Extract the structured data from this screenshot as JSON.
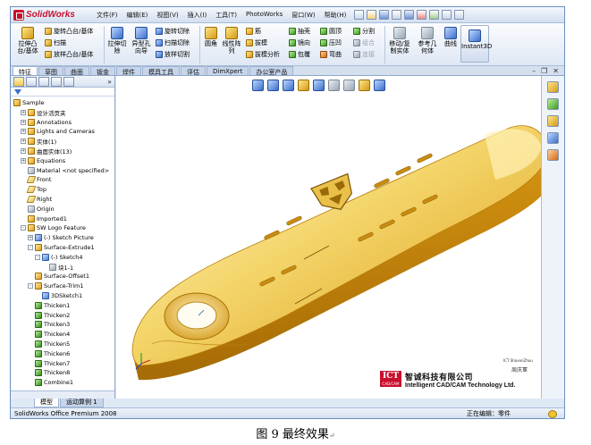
{
  "app": {
    "logo_text": "SolidWorks",
    "menu": [
      "文件(F)",
      "编辑(E)",
      "视图(V)",
      "插入(I)",
      "工具(T)",
      "PhotoWorks",
      "窗口(W)",
      "帮助(H)"
    ]
  },
  "ribbon": {
    "extrude_boss": "拉伸凸\n台/基体",
    "revolve_boss": "旋转凸台/基体",
    "sweep": "扫描",
    "loft_boss": "放样凸台/基体",
    "extrude_cut": "拉伸切\n除",
    "hole_wizard": "异型孔\n向导",
    "revolve_cut": "旋转切除",
    "swept_cut": "扫描切除",
    "lofted_cut": "放样切割",
    "fillet": "圆角",
    "linear_pattern": "线性阵\n列",
    "rib": "筋",
    "draft": "拔模",
    "draft_analysis": "拔模分析",
    "shell": "抽壳",
    "mirror": "镜向",
    "wrap": "包覆",
    "dome": "圆顶",
    "indent": "压凹",
    "flex": "弯曲",
    "split": "分割",
    "combine": "组合",
    "join": "连接",
    "move_copy": "移动/复\n制实体",
    "reference_geometry": "参考几\n何体",
    "curves": "曲线",
    "instant3d": "Instant3D"
  },
  "tabs": [
    "特征",
    "草图",
    "曲面",
    "钣金",
    "焊件",
    "模具工具",
    "评估",
    "DimXpert",
    "办公室产品"
  ],
  "tree": {
    "root": "Sample",
    "items": [
      {
        "label": "设计活页夹",
        "indent": 1,
        "icon": "yel",
        "exp": "+"
      },
      {
        "label": "Annotations",
        "indent": 1,
        "icon": "yel",
        "exp": "+"
      },
      {
        "label": "Lights and Cameras",
        "indent": 1,
        "icon": "yel",
        "exp": "+"
      },
      {
        "label": "实体(1)",
        "indent": 1,
        "icon": "yel",
        "exp": "+"
      },
      {
        "label": "曲面实体(13)",
        "indent": 1,
        "icon": "yel",
        "exp": "+"
      },
      {
        "label": "Equations",
        "indent": 1,
        "icon": "yel",
        "exp": "+"
      },
      {
        "label": "Material <not specified>",
        "indent": 1,
        "icon": "gry",
        "exp": ""
      },
      {
        "label": "Front",
        "indent": 1,
        "icon": "pln",
        "exp": ""
      },
      {
        "label": "Top",
        "indent": 1,
        "icon": "pln",
        "exp": ""
      },
      {
        "label": "Right",
        "indent": 1,
        "icon": "pln",
        "exp": ""
      },
      {
        "label": "Origin",
        "indent": 1,
        "icon": "gry",
        "exp": ""
      },
      {
        "label": "Imported1",
        "indent": 1,
        "icon": "yel",
        "exp": ""
      },
      {
        "label": "SW Logo Feature",
        "indent": 1,
        "icon": "yel",
        "exp": "-"
      },
      {
        "label": "(-) Sketch Picture",
        "indent": 2,
        "icon": "blu",
        "exp": "+"
      },
      {
        "label": "Surface-Extrude1",
        "indent": 2,
        "icon": "yel",
        "exp": "-"
      },
      {
        "label": "(-) Sketch4",
        "indent": 3,
        "icon": "blu",
        "exp": "-"
      },
      {
        "label": "块1-1",
        "indent": 4,
        "icon": "gry",
        "exp": ""
      },
      {
        "label": "Surface-Offset1",
        "indent": 2,
        "icon": "yel",
        "exp": ""
      },
      {
        "label": "Surface-Trim1",
        "indent": 2,
        "icon": "yel",
        "exp": "-"
      },
      {
        "label": "3DSketch1",
        "indent": 3,
        "icon": "blu",
        "exp": ""
      },
      {
        "label": "Thicken1",
        "indent": 2,
        "icon": "grn",
        "exp": ""
      },
      {
        "label": "Thicken2",
        "indent": 2,
        "icon": "grn",
        "exp": ""
      },
      {
        "label": "Thicken3",
        "indent": 2,
        "icon": "grn",
        "exp": ""
      },
      {
        "label": "Thicken4",
        "indent": 2,
        "icon": "grn",
        "exp": ""
      },
      {
        "label": "Thicken5",
        "indent": 2,
        "icon": "grn",
        "exp": ""
      },
      {
        "label": "Thicken6",
        "indent": 2,
        "icon": "grn",
        "exp": ""
      },
      {
        "label": "Thicken7",
        "indent": 2,
        "icon": "grn",
        "exp": ""
      },
      {
        "label": "Thicken8",
        "indent": 2,
        "icon": "grn",
        "exp": ""
      },
      {
        "label": "Combine1",
        "indent": 2,
        "icon": "grn",
        "exp": ""
      }
    ]
  },
  "bottom_tabs": [
    "模型",
    "运动算例 1"
  ],
  "logo_card": {
    "box": "ICT",
    "box_sub": "CAD/CAM",
    "cn_name": "智诚科技有限公司",
    "en_name": "Intelligent CAD/CAM Technology Ltd.",
    "tag": "ICT   ShavenZhou",
    "person": "周庆軍"
  },
  "status": {
    "left": "SolidWorks Office Premium 2008",
    "right": "正在编辑：零件"
  },
  "caption": {
    "text": "图 9  最终效果",
    "mark": "↵"
  }
}
